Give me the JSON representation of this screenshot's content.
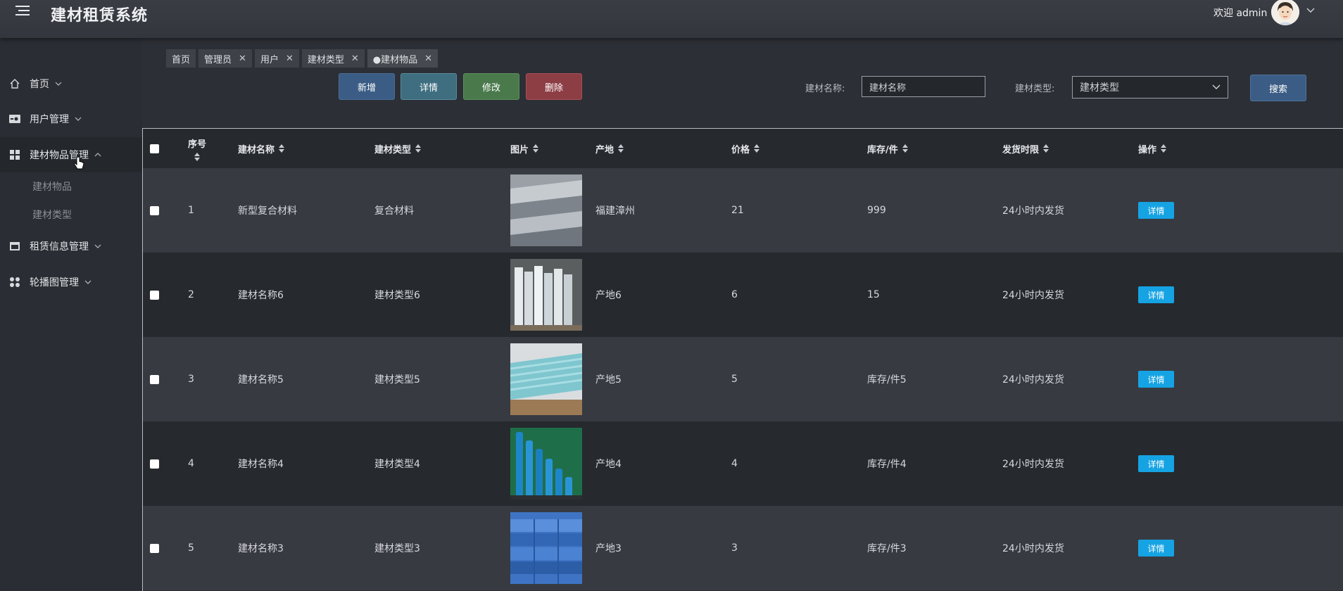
{
  "header": {
    "title": "建材租赁系统",
    "welcome": "欢迎 admin"
  },
  "sidebar": {
    "items": [
      {
        "label": "首页",
        "icon": "home-icon"
      },
      {
        "label": "用户管理",
        "icon": "user-card-icon"
      },
      {
        "label": "建材物品管理",
        "icon": "grid-icon"
      },
      {
        "label": "租赁信息管理",
        "icon": "window-icon"
      },
      {
        "label": "轮播图管理",
        "icon": "dots-icon"
      }
    ],
    "subitems": [
      "建材物品",
      "建材类型"
    ]
  },
  "tabs": [
    {
      "label": "首页",
      "closable": false
    },
    {
      "label": "管理员",
      "closable": true
    },
    {
      "label": "用户",
      "closable": true
    },
    {
      "label": "建材类型",
      "closable": true
    },
    {
      "label": "●建材物品",
      "closable": true
    }
  ],
  "toolbar": {
    "add": "新增",
    "detail": "详情",
    "edit": "修改",
    "delete": "删除",
    "name_label": "建材名称:",
    "name_placeholder": "建材名称",
    "type_label": "建材类型:",
    "type_placeholder": "建材类型",
    "search": "搜索"
  },
  "table": {
    "headers": [
      "序号",
      "建材名称",
      "建材类型",
      "图片",
      "产地",
      "价格",
      "库存/件",
      "发货时限",
      "操作"
    ],
    "rows": [
      {
        "no": "1",
        "name": "新型复合材料",
        "type": "复合材料",
        "origin": "福建漳州",
        "price": "21",
        "stock": "999",
        "delivery": "24小时内发货",
        "action": "详情"
      },
      {
        "no": "2",
        "name": "建材名称6",
        "type": "建材类型6",
        "origin": "产地6",
        "price": "6",
        "stock": "15",
        "delivery": "24小时内发货",
        "action": "详情"
      },
      {
        "no": "3",
        "name": "建材名称5",
        "type": "建材类型5",
        "origin": "产地5",
        "price": "5",
        "stock": "库存/件5",
        "delivery": "24小时内发货",
        "action": "详情"
      },
      {
        "no": "4",
        "name": "建材名称4",
        "type": "建材类型4",
        "origin": "产地4",
        "price": "4",
        "stock": "库存/件4",
        "delivery": "24小时内发货",
        "action": "详情"
      },
      {
        "no": "5",
        "name": "建材名称3",
        "type": "建材类型3",
        "origin": "产地3",
        "price": "3",
        "stock": "库存/件3",
        "delivery": "24小时内发货",
        "action": "详情"
      }
    ]
  },
  "colors": {
    "accent": "#15a3e3",
    "add": "#3b5d85",
    "detail": "#3e6e80",
    "edit": "#4a7a4c",
    "delete": "#8d3e45"
  }
}
